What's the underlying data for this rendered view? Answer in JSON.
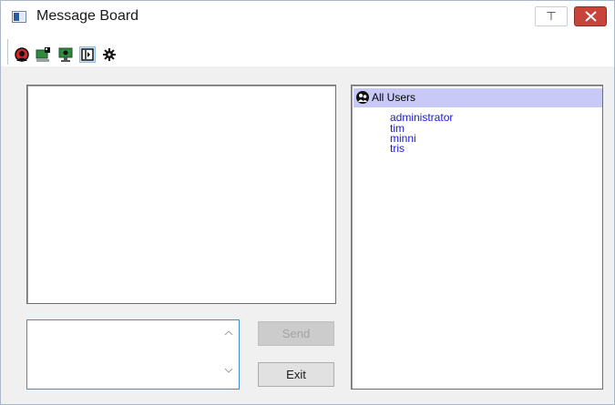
{
  "window": {
    "title": "Message Board",
    "pin_glyph": "⊤"
  },
  "toolbar": {
    "tools": [
      {
        "icon": "block-user-icon"
      },
      {
        "icon": "monitor-share-icon"
      },
      {
        "icon": "monitor-view-icon"
      },
      {
        "icon": "panel-toggle-icon"
      },
      {
        "icon": "gear-icon"
      }
    ]
  },
  "chat": {
    "messages_text": "",
    "input_value": ""
  },
  "buttons": {
    "send": "Send",
    "exit": "Exit"
  },
  "users": {
    "header": "All Users",
    "list": [
      "administrator",
      "tim",
      "minni",
      "tris"
    ]
  },
  "colors": {
    "user_text": "#1a1ad0",
    "header_bg": "#c9c9f7",
    "close_bg": "#c8433a"
  }
}
